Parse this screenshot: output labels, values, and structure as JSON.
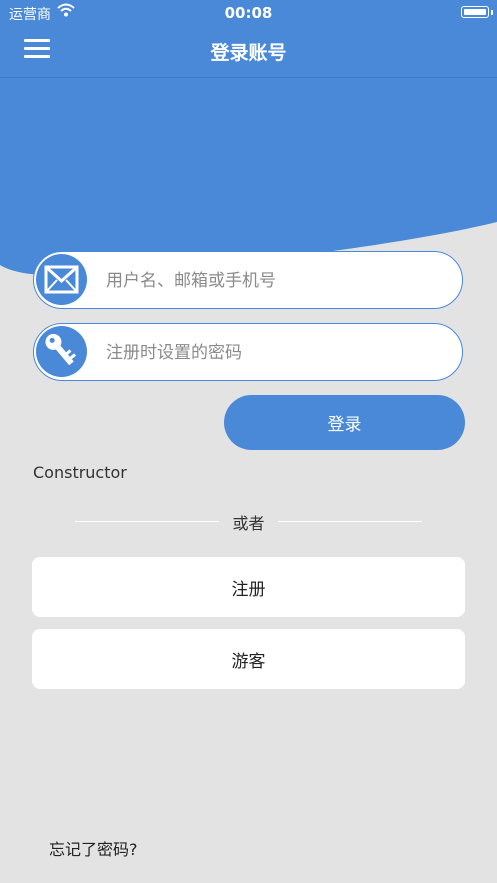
{
  "status_bar": {
    "carrier": "运营商",
    "time": "00:08"
  },
  "nav": {
    "title": "登录账号",
    "menu_icon": "hamburger-menu-icon"
  },
  "form": {
    "username_placeholder": "用户名、邮箱或手机号",
    "password_placeholder": "注册时设置的密码",
    "login_label": "登录",
    "username_icon": "envelope-icon",
    "password_icon": "key-icon"
  },
  "constructor_label": "Constructor",
  "divider_text": "或者",
  "register_label": "注册",
  "guest_label": "游客",
  "forgot_label": "忘记了密码?",
  "colors": {
    "primary": "#4a88d8",
    "background": "#e3e3e3",
    "card": "#ffffff"
  }
}
